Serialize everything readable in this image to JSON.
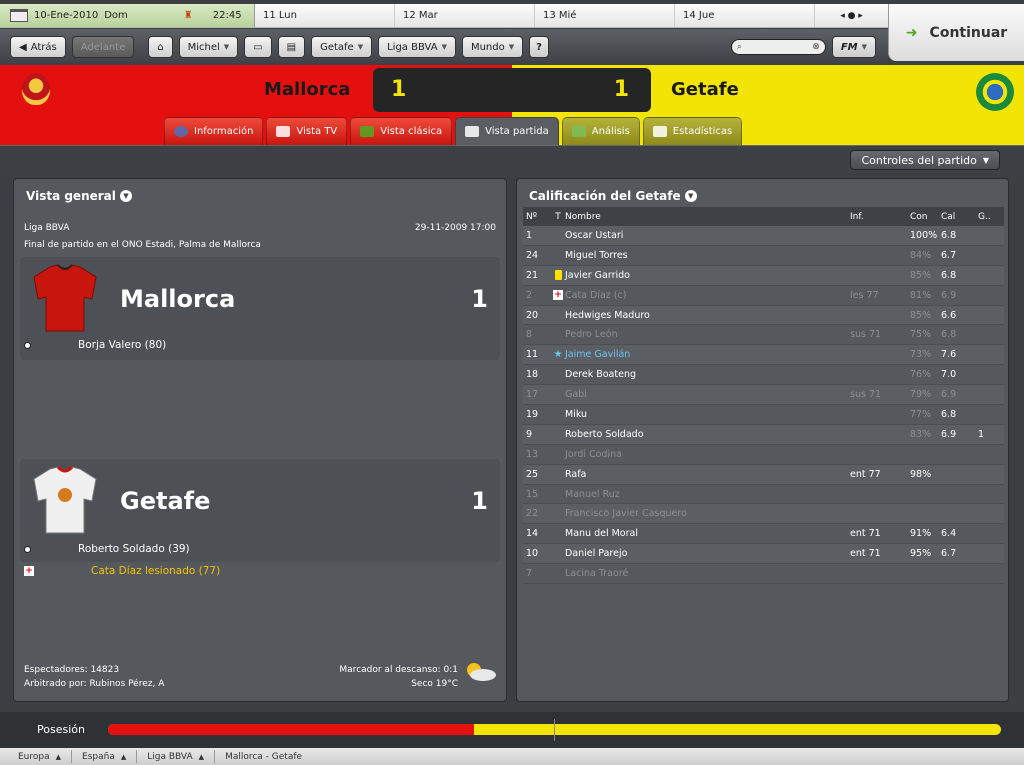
{
  "calendar": {
    "today": "10-Ene-2010",
    "weekday": "Dom",
    "time": "22:45",
    "days": [
      "11 Lun",
      "12 Mar",
      "13 Mié",
      "14 Jue"
    ],
    "nav": "◂ ● ▸"
  },
  "toolbar": {
    "back": "Atrás",
    "forward": "Adelante",
    "manager": "Michel",
    "team": "Getafe",
    "league": "Liga BBVA",
    "world": "Mundo",
    "help": "?",
    "fm": "FM"
  },
  "continue_label": "Continuar",
  "match": {
    "home": "Mallorca",
    "away": "Getafe",
    "home_score": "1",
    "away_score": "1",
    "colors": {
      "home": "#e3100f",
      "away": "#f2e505"
    }
  },
  "tabs": [
    "Información",
    "Vista TV",
    "Vista clásica",
    "Vista partida",
    "Análisis",
    "Estadísticas"
  ],
  "controls_label": "Controles del partido",
  "overview": {
    "title": "Vista general",
    "competition": "Liga BBVA",
    "datetime": "29-11-2009 17:00",
    "venue": "Final de partido en el ONO Estadi, Palma de Mallorca",
    "home_name": "Mallorca",
    "home_score": "1",
    "home_events": [
      {
        "icon": "ball-icon",
        "text": "Borja Valero (80)"
      }
    ],
    "away_name": "Getafe",
    "away_score": "1",
    "away_events": [
      {
        "icon": "ball-icon",
        "text": "Roberto Soldado (39)"
      },
      {
        "icon": "injury-icon",
        "text": "Cata Díaz lesionado (77)"
      }
    ],
    "attendance": "Espectadores: 14823",
    "referee": "Arbitrado por: Rubinos Pérez, A",
    "halftime": "Marcador al descanso: 0:1",
    "weather": "Seco 19°C"
  },
  "ratings": {
    "title": "Calificación del Getafe",
    "headers": [
      "Nº",
      "T",
      "Nombre",
      "Inf.",
      "Con",
      "Cal",
      "G.."
    ],
    "rows": [
      {
        "n": "1",
        "name": "Oscar Ustari",
        "inf": "",
        "con": "100%",
        "cal": "6.8",
        "g": "",
        "dim": false
      },
      {
        "n": "24",
        "name": "Miguel Torres",
        "inf": "",
        "con": "84%",
        "cal": "6.7",
        "g": "",
        "dim": false
      },
      {
        "n": "21",
        "name": "Javier Garrido",
        "inf": "",
        "con": "85%",
        "cal": "6.8",
        "g": "",
        "dim": false,
        "tag": "yellow"
      },
      {
        "n": "2",
        "name": "Cata Díaz (c)",
        "inf": "les 77",
        "con": "81%",
        "cal": "6.9",
        "g": "",
        "dim": true,
        "tag": "injury"
      },
      {
        "n": "20",
        "name": "Hedwiges Maduro",
        "inf": "",
        "con": "85%",
        "cal": "6.6",
        "g": "",
        "dim": false
      },
      {
        "n": "8",
        "name": "Pedro León",
        "inf": "sus 71",
        "con": "75%",
        "cal": "6.8",
        "g": "",
        "dim": true
      },
      {
        "n": "11",
        "name": "Jaime Gavilán",
        "inf": "",
        "con": "73%",
        "cal": "7.6",
        "g": "",
        "dim": false,
        "tag": "star"
      },
      {
        "n": "18",
        "name": "Derek Boateng",
        "inf": "",
        "con": "76%",
        "cal": "7.0",
        "g": "",
        "dim": false
      },
      {
        "n": "17",
        "name": "Gabi",
        "inf": "sus 71",
        "con": "79%",
        "cal": "6.9",
        "g": "",
        "dim": true
      },
      {
        "n": "19",
        "name": "Miku",
        "inf": "",
        "con": "77%",
        "cal": "6.8",
        "g": "",
        "dim": false
      },
      {
        "n": "9",
        "name": "Roberto Soldado",
        "inf": "",
        "con": "83%",
        "cal": "6.9",
        "g": "1",
        "dim": false
      },
      {
        "n": "13",
        "name": "Jordi Codina",
        "inf": "",
        "con": "",
        "cal": "",
        "g": "",
        "dim": true
      },
      {
        "n": "25",
        "name": "Rafa",
        "inf": "ent 77",
        "con": "98%",
        "cal": "",
        "g": "",
        "dim": false
      },
      {
        "n": "15",
        "name": "Manuel Ruz",
        "inf": "",
        "con": "",
        "cal": "",
        "g": "",
        "dim": true
      },
      {
        "n": "22",
        "name": "Francisco Javier Casquero",
        "inf": "",
        "con": "",
        "cal": "",
        "g": "",
        "dim": true
      },
      {
        "n": "14",
        "name": "Manu del Moral",
        "inf": "ent 71",
        "con": "91%",
        "cal": "6.4",
        "g": "",
        "dim": false
      },
      {
        "n": "10",
        "name": "Daniel Parejo",
        "inf": "ent 71",
        "con": "95%",
        "cal": "6.7",
        "g": "",
        "dim": false
      },
      {
        "n": "7",
        "name": "Lacina Traoré",
        "inf": "",
        "con": "",
        "cal": "",
        "g": "",
        "dim": true
      }
    ]
  },
  "possession": {
    "label": "Posesión",
    "home_share": 0.41
  },
  "breadcrumbs": [
    "Europa",
    "España",
    "Liga BBVA",
    "Mallorca - Getafe"
  ]
}
